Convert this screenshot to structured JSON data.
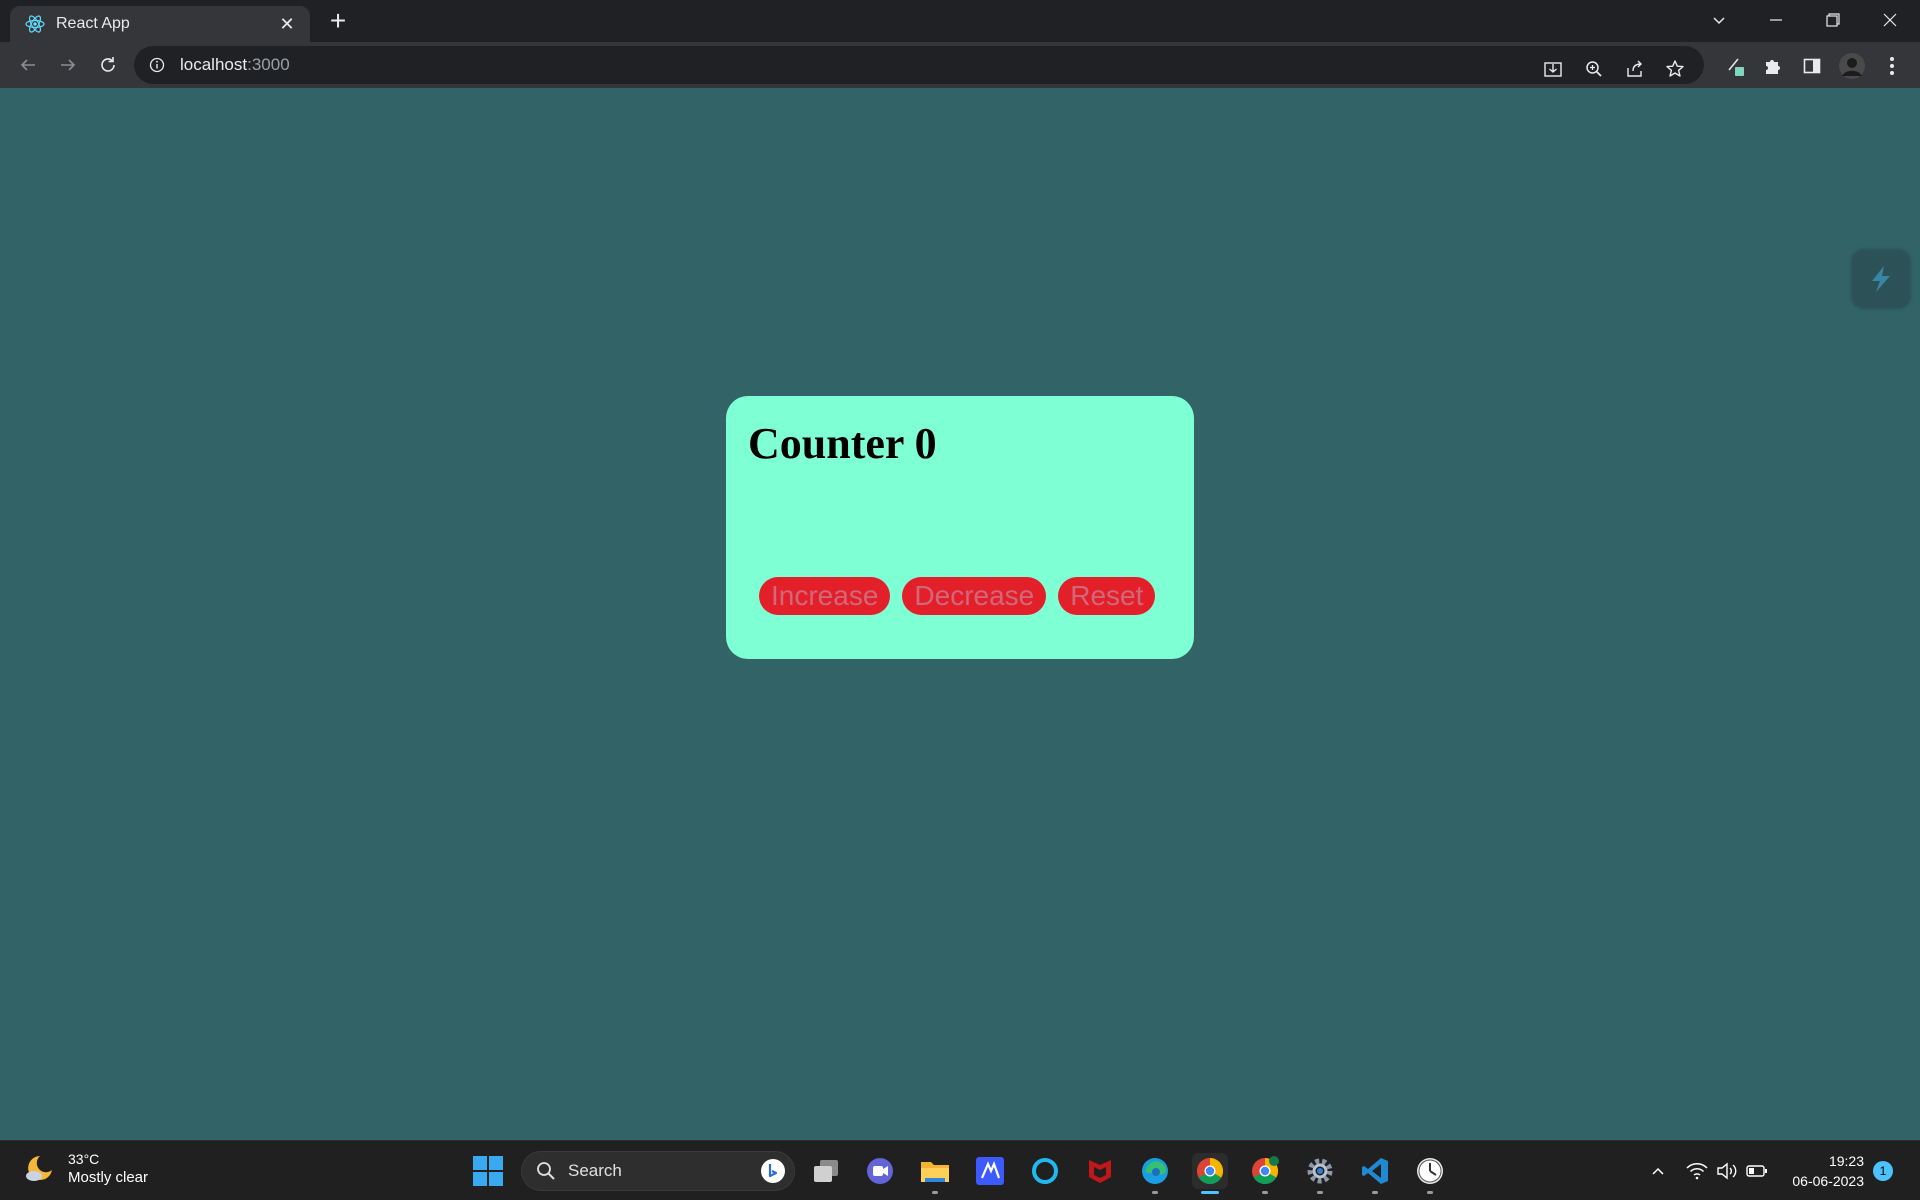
{
  "browser": {
    "tab": {
      "title": "React App",
      "favicon": "react-icon"
    },
    "address": {
      "host": "localhost",
      "port": ":3000"
    },
    "window_controls": [
      "tab-search-icon",
      "minimize-icon",
      "restore-icon",
      "close-icon"
    ],
    "toolbar_icons": [
      "install-app-icon",
      "zoom-icon",
      "share-icon",
      "bookmark-star-icon",
      "extension-pen-icon",
      "extensions-puzzle-icon",
      "side-panel-icon",
      "profile-avatar",
      "menu-kebab-icon"
    ]
  },
  "page": {
    "title": "Counter 0",
    "buttons": {
      "increase": "Increase",
      "decrease": "Decrease",
      "reset": "Reset"
    },
    "colors": {
      "background": "#316367",
      "card": "#7fffd4",
      "button": "#e3202a"
    }
  },
  "taskbar": {
    "weather": {
      "temp": "33°C",
      "condition": "Mostly clear",
      "icon": "moon-cloud-icon"
    },
    "search_label": "Search",
    "apps": [
      "task-view-icon",
      "chat-icon",
      "file-explorer-icon",
      "trello-icon",
      "cortana-icon",
      "mcafee-icon",
      "edge-icon",
      "chrome-icon",
      "chrome-profile-icon",
      "settings-icon",
      "vscode-icon",
      "clock-app-icon"
    ],
    "clock": {
      "time": "19:23",
      "date": "06-06-2023"
    },
    "notification_count": "1"
  }
}
